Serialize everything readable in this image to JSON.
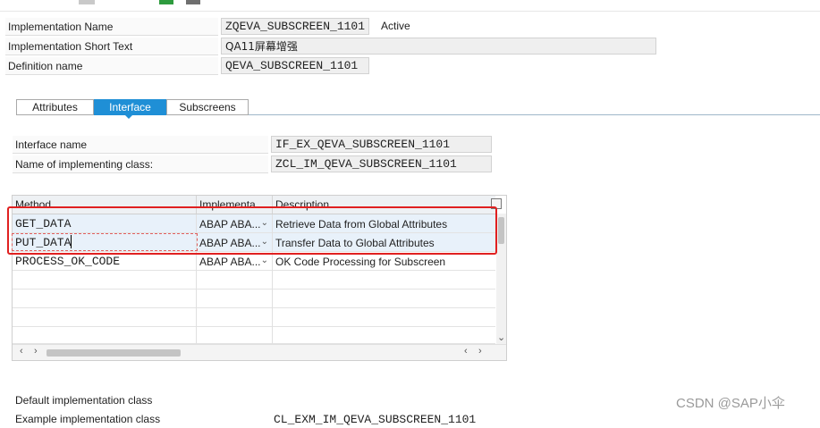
{
  "header": {
    "impl_name_label": "Implementation Name",
    "impl_name_value": "ZQEVA_SUBSCREEN_1101",
    "impl_status": "Active",
    "short_text_label": "Implementation Short Text",
    "short_text_value": "QA11屏幕增强",
    "definition_label": "Definition name",
    "definition_value": "QEVA_SUBSCREEN_1101"
  },
  "tabs": [
    {
      "label": "Attributes"
    },
    {
      "label": "Interface"
    },
    {
      "label": "Subscreens"
    }
  ],
  "interface": {
    "interface_name_label": "Interface name",
    "interface_name_value": "IF_EX_QEVA_SUBSCREEN_1101",
    "impl_class_label": "Name of implementing class:",
    "impl_class_value": "ZCL_IM_QEVA_SUBSCREEN_1101"
  },
  "methods_table": {
    "columns": [
      "Method",
      "Implementa...",
      "Description"
    ],
    "rows": [
      {
        "method": "GET_DATA",
        "impl": "ABAP ABA...",
        "desc": "Retrieve Data from Global Attributes"
      },
      {
        "method": "PUT_DATA",
        "impl": "ABAP ABA...",
        "desc": "Transfer Data to Global Attributes"
      },
      {
        "method": "PROCESS_OK_CODE",
        "impl": "ABAP ABA...",
        "desc": "OK Code Processing for Subscreen"
      }
    ]
  },
  "bottom": {
    "default_class_label": "Default implementation class",
    "example_class_label": "Example implementation class",
    "example_class_value": "CL_EXM_IM_QEVA_SUBSCREEN_1101"
  },
  "watermark": "CSDN @SAP小伞",
  "colors": {
    "active_tab": "#1f8fd6",
    "highlight_border": "#e02020"
  }
}
